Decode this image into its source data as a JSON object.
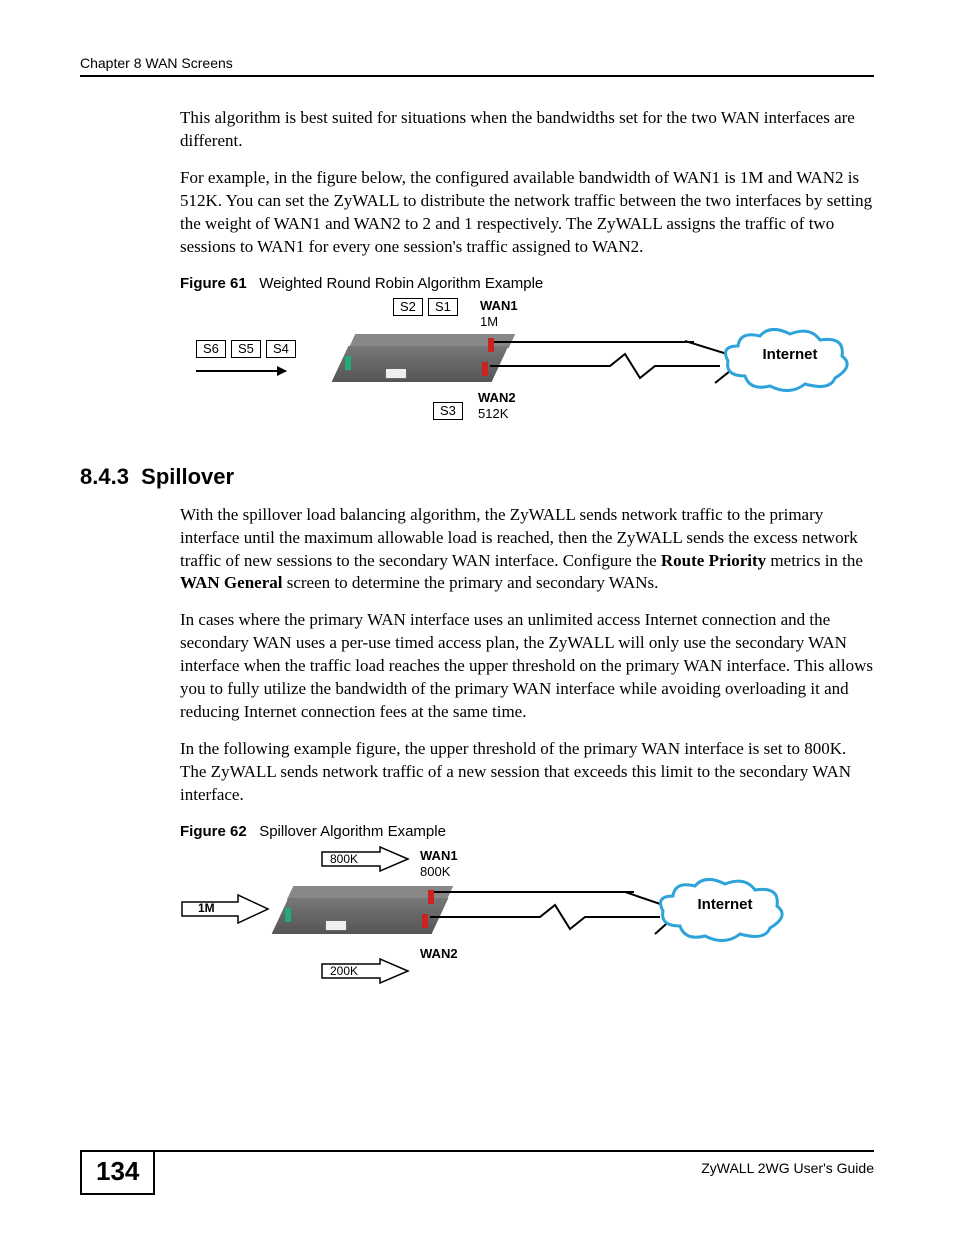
{
  "header": {
    "chapter": "Chapter 8 WAN Screens"
  },
  "para1": "This algorithm is best suited for situations when the bandwidths set for the two WAN interfaces are different.",
  "para2": "For example, in the figure below, the configured available bandwidth of WAN1 is 1M and WAN2 is 512K. You can set the ZyWALL to distribute the network traffic between the two interfaces by setting the weight of WAN1 and WAN2 to 2 and 1 respectively. The ZyWALL assigns the traffic of two sessions to WAN1 for every one session's traffic assigned to WAN2.",
  "fig61": {
    "label": "Figure 61",
    "title": "Weighted Round Robin Algorithm Example",
    "s1": "S1",
    "s2": "S2",
    "s3": "S3",
    "s4": "S4",
    "s5": "S5",
    "s6": "S6",
    "wan1": "WAN1",
    "wan1_bw": "1M",
    "wan2": "WAN2",
    "wan2_bw": "512K",
    "internet": "Internet"
  },
  "section": {
    "num": "8.4.3",
    "title": "Spillover"
  },
  "para3_a": "With the spillover load balancing algorithm, the ZyWALL sends network traffic to the primary interface until the maximum allowable load is reached, then the ZyWALL sends the excess network traffic of new sessions to the secondary WAN interface. Configure the ",
  "para3_b1": "Route Priority",
  "para3_c": " metrics in the ",
  "para3_b2": "WAN General",
  "para3_d": " screen to determine the primary and secondary WANs.",
  "para4": "In cases where the primary WAN interface uses an unlimited access Internet connection and the secondary WAN uses a per-use timed access plan, the ZyWALL will only use the secondary WAN interface when the traffic load reaches the upper threshold on the primary WAN interface. This allows you to fully utilize the bandwidth of the primary WAN interface while avoiding overloading it and reducing Internet connection fees at the same time.",
  "para5": "In the following example figure, the upper threshold of the primary WAN interface is set to 800K. The ZyWALL sends network traffic of a new session that exceeds this limit to the secondary WAN interface.",
  "fig62": {
    "label": "Figure 62",
    "title": "Spillover Algorithm Example",
    "in_bw": "1M",
    "top_bw": "800K",
    "bot_bw": "200K",
    "wan1": "WAN1",
    "wan1_bw": "800K",
    "wan2": "WAN2",
    "internet": "Internet"
  },
  "footer": {
    "page": "134",
    "guide": "ZyWALL 2WG User's Guide"
  }
}
